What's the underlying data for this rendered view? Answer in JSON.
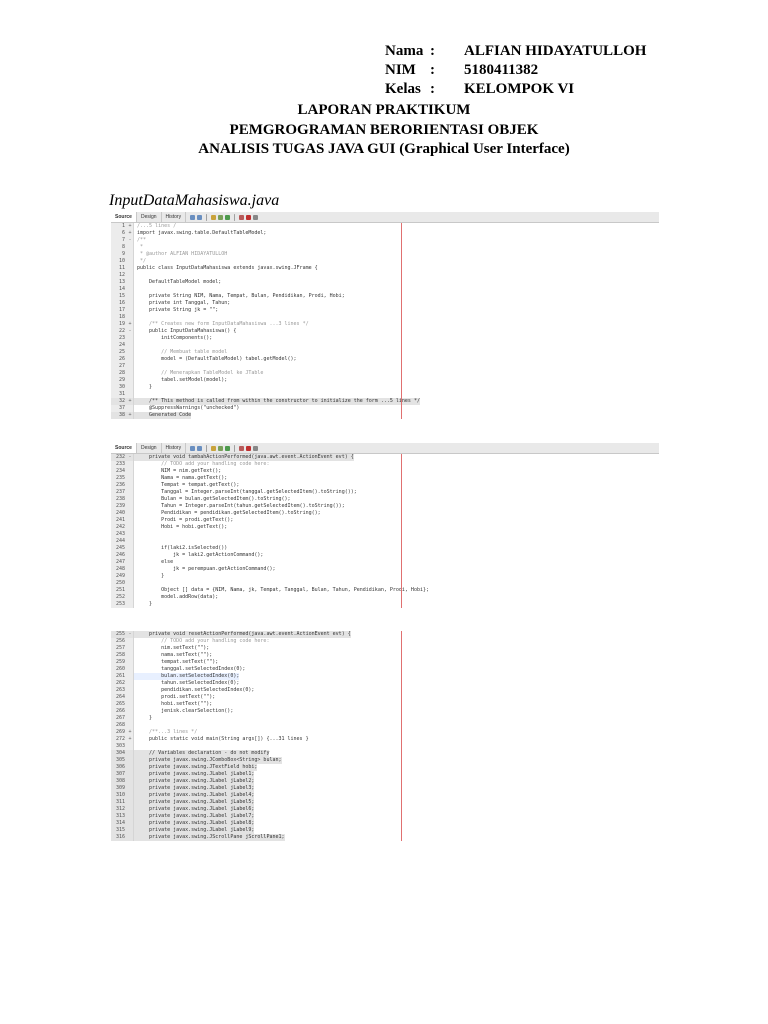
{
  "header": {
    "rows": [
      {
        "label": "Nama",
        "sep": ":",
        "value": "ALFIAN HIDAYATULLOH"
      },
      {
        "label": "NIM",
        "sep": ":",
        "value": "5180411382"
      },
      {
        "label": "Kelas",
        "sep": ":",
        "value": "KELOMPOK VI"
      }
    ]
  },
  "titles": [
    "LAPORAN PRAKTIKUM",
    "PEMGROGRAMAN BERORIENTASI OBJEK",
    "ANALISIS TUGAS JAVA GUI (Graphical User Interface)"
  ],
  "filename": "InputDataMahasiswa.java",
  "editor_tabs": [
    "Source",
    "Design",
    "History"
  ],
  "panel1": [
    {
      "n": "1",
      "f": "+",
      "t": "/...5 lines /",
      "s": "cmt"
    },
    {
      "n": "6",
      "f": "+",
      "t": "import javax.swing.table.DefaultTableModel;"
    },
    {
      "n": "7",
      "f": "-",
      "t": "/**",
      "s": "cmt"
    },
    {
      "n": "8",
      "f": "",
      "t": " *",
      "s": "cmt"
    },
    {
      "n": "9",
      "f": "",
      "t": " * @author ALFIAN HIDAYATULLOH",
      "s": "cmt"
    },
    {
      "n": "10",
      "f": "",
      "t": " */",
      "s": "cmt"
    },
    {
      "n": "11",
      "f": "",
      "t": "public class InputDataMahasiswa extends javax.swing.JFrame {"
    },
    {
      "n": "12",
      "f": "",
      "t": ""
    },
    {
      "n": "13",
      "f": "",
      "t": "    DefaultTableModel model;"
    },
    {
      "n": "14",
      "f": "",
      "t": ""
    },
    {
      "n": "15",
      "f": "",
      "t": "    private String NIM, Nama, Tempat, Bulan, Pendidikan, Prodi, Hobi;"
    },
    {
      "n": "16",
      "f": "",
      "t": "    private int Tanggal, Tahun;"
    },
    {
      "n": "17",
      "f": "",
      "t": "    private String jk = \"\";"
    },
    {
      "n": "18",
      "f": "",
      "t": ""
    },
    {
      "n": "19",
      "f": "+",
      "t": "    /** Creates new form InputDataMahasiswa ...3 lines */",
      "s": "cmt"
    },
    {
      "n": "22",
      "f": "-",
      "t": "    public InputDataMahasiswa() {"
    },
    {
      "n": "23",
      "f": "",
      "t": "        initComponents();"
    },
    {
      "n": "24",
      "f": "",
      "t": ""
    },
    {
      "n": "25",
      "f": "",
      "t": "        // Membuat table model",
      "s": "cmt"
    },
    {
      "n": "26",
      "f": "",
      "t": "        model = (DefaultTableModel) tabel.getModel();"
    },
    {
      "n": "27",
      "f": "",
      "t": ""
    },
    {
      "n": "28",
      "f": "",
      "t": "        // Menerapkan TableModel ke JTable",
      "s": "cmt"
    },
    {
      "n": "29",
      "f": "",
      "t": "        tabel.setModel(model);"
    },
    {
      "n": "30",
      "f": "",
      "t": "    }"
    },
    {
      "n": "31",
      "f": "",
      "t": ""
    },
    {
      "n": "32",
      "f": "+",
      "t": "    /** This method is called from within the constructor to initialize the form ...5 lines */",
      "s": "hl"
    },
    {
      "n": "37",
      "f": "",
      "t": "    @SuppressWarnings(\"unchecked\")"
    },
    {
      "n": "38",
      "f": "+",
      "t": "    Generated Code",
      "s": "hl"
    }
  ],
  "panel2": [
    {
      "n": "232",
      "f": "-",
      "t": "    private void tambahActionPerformed(java.awt.event.ActionEvent evt) {",
      "s": "hl"
    },
    {
      "n": "233",
      "f": "",
      "t": "        // TODO add your handling code here:",
      "s": "cmt"
    },
    {
      "n": "234",
      "f": "",
      "t": "        NIM = nim.getText();"
    },
    {
      "n": "235",
      "f": "",
      "t": "        Nama = nama.getText();"
    },
    {
      "n": "236",
      "f": "",
      "t": "        Tempat = tempat.getText();"
    },
    {
      "n": "237",
      "f": "",
      "t": "        Tanggal = Integer.parseInt(tanggal.getSelectedItem().toString());"
    },
    {
      "n": "238",
      "f": "",
      "t": "        Bulan = bulan.getSelectedItem().toString();"
    },
    {
      "n": "239",
      "f": "",
      "t": "        Tahun = Integer.parseInt(tahun.getSelectedItem().toString());"
    },
    {
      "n": "240",
      "f": "",
      "t": "        Pendidikan = pendidikan.getSelectedItem().toString();"
    },
    {
      "n": "241",
      "f": "",
      "t": "        Prodi = prodi.getText();"
    },
    {
      "n": "242",
      "f": "",
      "t": "        Hobi = hobi.getText();"
    },
    {
      "n": "243",
      "f": "",
      "t": ""
    },
    {
      "n": "244",
      "f": "",
      "t": ""
    },
    {
      "n": "245",
      "f": "",
      "t": "        if(laki2.isSelected())"
    },
    {
      "n": "246",
      "f": "",
      "t": "            jk = laki2.getActionCommand();"
    },
    {
      "n": "247",
      "f": "",
      "t": "        else"
    },
    {
      "n": "248",
      "f": "",
      "t": "            jk = perempuan.getActionCommand();"
    },
    {
      "n": "249",
      "f": "",
      "t": "        }"
    },
    {
      "n": "250",
      "f": "",
      "t": ""
    },
    {
      "n": "251",
      "f": "",
      "t": "        Object [] data = {NIM, Nama, jk, Tempat, Tanggal, Bulan, Tahun, Pendidikan, Prodi, Hobi};"
    },
    {
      "n": "252",
      "f": "",
      "t": "        model.addRow(data);"
    },
    {
      "n": "253",
      "f": "",
      "t": "    }"
    }
  ],
  "panel3": [
    {
      "n": "255",
      "f": "-",
      "t": "    private void resetActionPerformed(java.awt.event.ActionEvent evt) {",
      "s": "hl"
    },
    {
      "n": "256",
      "f": "",
      "t": "        // TODO add your handling code here:",
      "s": "cmt"
    },
    {
      "n": "257",
      "f": "",
      "t": "        nim.setText(\"\");"
    },
    {
      "n": "258",
      "f": "",
      "t": "        nama.setText(\"\");"
    },
    {
      "n": "259",
      "f": "",
      "t": "        tempat.setText(\"\");"
    },
    {
      "n": "260",
      "f": "",
      "t": "        tanggal.setSelectedIndex(0);"
    },
    {
      "n": "261",
      "f": "",
      "t": "        bulan.setSelectedIndex(0);",
      "s": "cur"
    },
    {
      "n": "262",
      "f": "",
      "t": "        tahun.setSelectedIndex(0);"
    },
    {
      "n": "263",
      "f": "",
      "t": "        pendidikan.setSelectedIndex(0);"
    },
    {
      "n": "264",
      "f": "",
      "t": "        prodi.setText(\"\");"
    },
    {
      "n": "265",
      "f": "",
      "t": "        hobi.setText(\"\");"
    },
    {
      "n": "266",
      "f": "",
      "t": "        jenisk.clearSelection();"
    },
    {
      "n": "267",
      "f": "",
      "t": "    }"
    },
    {
      "n": "268",
      "f": "",
      "t": ""
    },
    {
      "n": "269",
      "f": "+",
      "t": "    /**...3 lines */",
      "s": "cmt"
    },
    {
      "n": "272",
      "f": "+",
      "t": "    public static void main(String args[]) {...31 lines }"
    },
    {
      "n": "303",
      "f": "",
      "t": ""
    },
    {
      "n": "304",
      "f": "",
      "t": "    // Variables declaration - do not modify",
      "s": "hl"
    },
    {
      "n": "305",
      "f": "",
      "t": "    private javax.swing.JComboBox<String> bulan;",
      "s": "hl"
    },
    {
      "n": "306",
      "f": "",
      "t": "    private javax.swing.JTextField hobi;",
      "s": "hl"
    },
    {
      "n": "307",
      "f": "",
      "t": "    private javax.swing.JLabel jLabel1;",
      "s": "hl"
    },
    {
      "n": "308",
      "f": "",
      "t": "    private javax.swing.JLabel jLabel2;",
      "s": "hl"
    },
    {
      "n": "309",
      "f": "",
      "t": "    private javax.swing.JLabel jLabel3;",
      "s": "hl"
    },
    {
      "n": "310",
      "f": "",
      "t": "    private javax.swing.JLabel jLabel4;",
      "s": "hl"
    },
    {
      "n": "311",
      "f": "",
      "t": "    private javax.swing.JLabel jLabel5;",
      "s": "hl"
    },
    {
      "n": "312",
      "f": "",
      "t": "    private javax.swing.JLabel jLabel6;",
      "s": "hl"
    },
    {
      "n": "313",
      "f": "",
      "t": "    private javax.swing.JLabel jLabel7;",
      "s": "hl"
    },
    {
      "n": "314",
      "f": "",
      "t": "    private javax.swing.JLabel jLabel8;",
      "s": "hl"
    },
    {
      "n": "315",
      "f": "",
      "t": "    private javax.swing.JLabel jLabel9;",
      "s": "hl"
    },
    {
      "n": "316",
      "f": "",
      "t": "    private javax.swing.JScrollPane jScrollPane1;",
      "s": "hl"
    }
  ],
  "colors": {
    "margin_line": "#e07070",
    "toolbar_bg": "#e9e9e9"
  },
  "toolbar_icons": [
    "back-icon",
    "forward-icon",
    "find-icon",
    "toggle-icon",
    "run-icon",
    "debug-icon",
    "stop-icon",
    "comment-icon"
  ]
}
